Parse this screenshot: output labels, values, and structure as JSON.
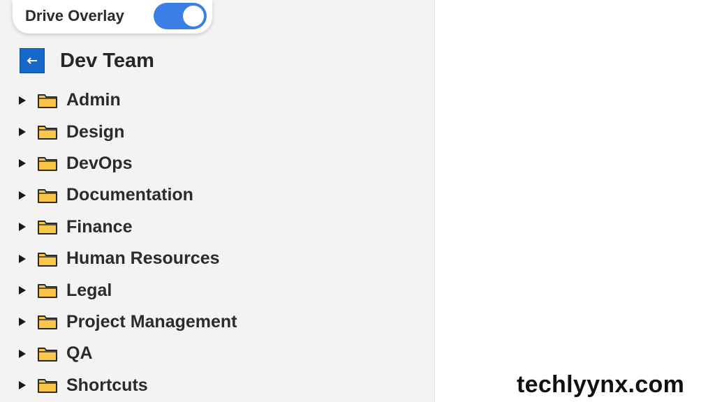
{
  "overlay_toggle": {
    "label": "Drive Overlay",
    "on": true
  },
  "header": {
    "back_icon": "back-arrow-icon",
    "title": "Dev Team"
  },
  "folders": [
    {
      "label": "Admin"
    },
    {
      "label": "Design"
    },
    {
      "label": "DevOps"
    },
    {
      "label": "Documentation"
    },
    {
      "label": "Finance"
    },
    {
      "label": "Human Resources"
    },
    {
      "label": "Legal"
    },
    {
      "label": "Project Management"
    },
    {
      "label": "QA"
    },
    {
      "label": "Shortcuts"
    }
  ],
  "watermark": "techlyynx.com",
  "colors": {
    "toggle_on": "#3b7fe6",
    "back_button": "#1769c9",
    "folder_fill": "#f9c64a",
    "folder_stroke": "#2b2b2b"
  }
}
